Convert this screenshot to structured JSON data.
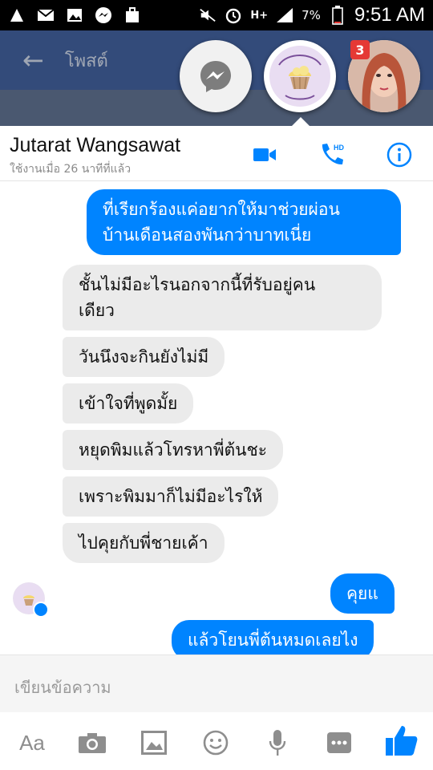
{
  "status_bar": {
    "battery_percent": "7%",
    "network": "H+",
    "time": "9:51 AM"
  },
  "background_app": {
    "back_arrow": "←",
    "title": "โพสต์"
  },
  "chat_heads": {
    "badge_count": "3"
  },
  "chat": {
    "contact_name": "Jutarat Wangsawat",
    "contact_status": "ใช้งานเมื่อ 26 นาทีที่แล้ว",
    "messages": [
      {
        "dir": "out",
        "lines": [
          "ที่เรียกร้องแค่อยากให้มาช่วยผ่อน",
          "บ้านเดือนสองพันกว่าบาทเนี่ย"
        ]
      },
      {
        "dir": "in",
        "lines": [
          "ชั้นไม่มีอะไรนอกจากนี้ที่รับอยู่คน",
          "เดียว"
        ]
      },
      {
        "dir": "in",
        "text": "วันนึงจะกินยังไม่มี"
      },
      {
        "dir": "in",
        "text": "เข้าใจที่พูดมั้ย"
      },
      {
        "dir": "in",
        "text": "หยุดพิมแล้วโทรหาพี่ต้นชะ"
      },
      {
        "dir": "in",
        "text": "เพราะพิมมาก็ไม่มีอะไรให้"
      },
      {
        "dir": "in",
        "text": "ไปคุยกับพี่ชายเค้า"
      },
      {
        "dir": "out",
        "text": "คุยแ"
      },
      {
        "dir": "out",
        "text": "แล้วโยนพี่ต้นหมดเลยไง"
      }
    ],
    "composer_placeholder": "เขียนข้อความ",
    "toolbar": {
      "text_format_label": "Aa"
    }
  },
  "colors": {
    "accent": "#0084ff",
    "incoming_bubble": "#ebebeb",
    "header_bg": "#3b5998"
  },
  "icons": [
    "notification-icon",
    "mail-icon",
    "image-icon",
    "messenger-icon",
    "bag-icon",
    "mute-icon",
    "alarm-icon",
    "signal-icon",
    "battery-icon",
    "video-call-icon",
    "phone-hd-icon",
    "info-icon",
    "camera-icon",
    "gallery-icon",
    "emoji-icon",
    "mic-icon",
    "more-icon",
    "like-icon"
  ]
}
